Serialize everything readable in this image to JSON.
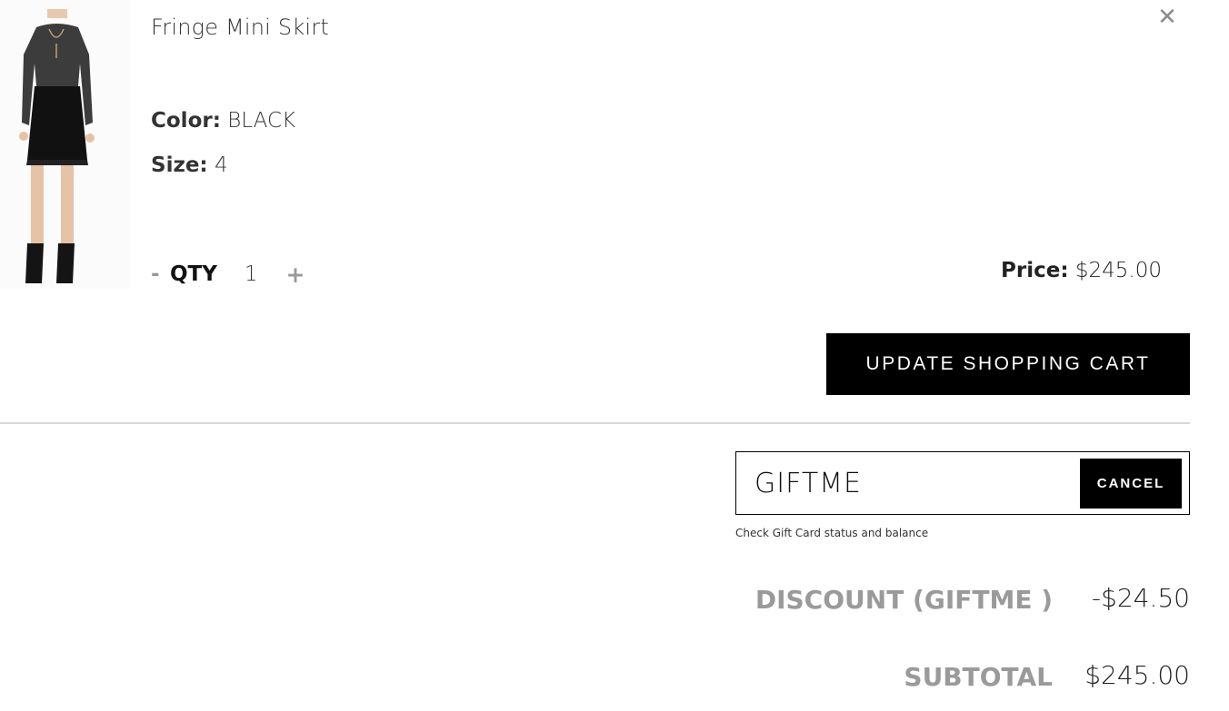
{
  "cart_item": {
    "name": "Fringe Mini Skirt",
    "image_alt": "Model wearing black long-sleeve sheer top with fringe mini skirt and black ankle boots",
    "color_label": "Color:",
    "color_value": "BLACK",
    "size_label": "Size:",
    "size_value": "4",
    "qty_minus": "-",
    "qty_label": "QTY",
    "qty_value": "1",
    "qty_plus": "+",
    "price_label": "Price:",
    "price_value": "$245.00",
    "close_icon": "close-icon"
  },
  "actions": {
    "update_cart_label": "UPDATE SHOPPING CART"
  },
  "gift": {
    "code_value": "GIFTME",
    "cancel_label": "CANCEL",
    "status_link": "Check Gift Card status and balance"
  },
  "summary": {
    "discount_label": "DISCOUNT (GIFTME )",
    "discount_value": "-$24.50",
    "subtotal_label": "SUBTOTAL",
    "subtotal_value": "$245.00"
  },
  "colors": {
    "accent": "#000000",
    "muted_label": "#9a9a9a",
    "divider": "#d9d9d9"
  }
}
